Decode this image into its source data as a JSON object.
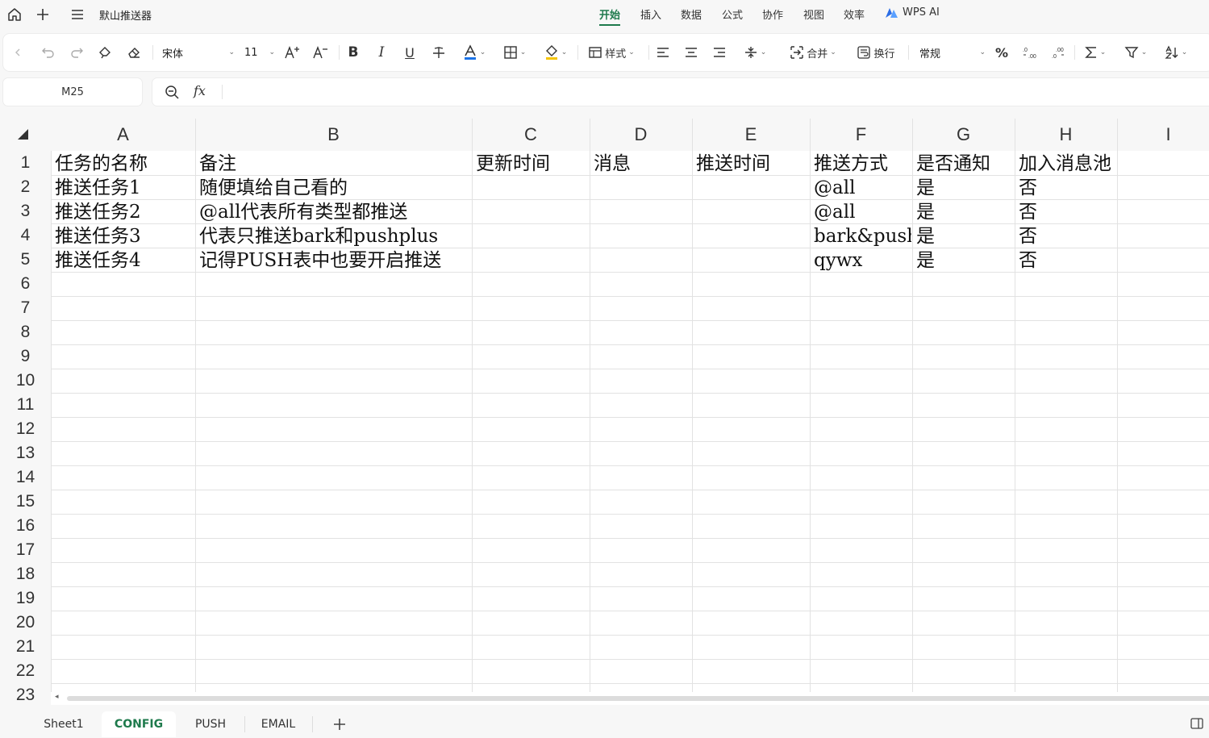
{
  "titlebar": {
    "doc_title": "默山推送器",
    "menu": [
      "开始",
      "插入",
      "数据",
      "公式",
      "协作",
      "视图",
      "效率"
    ],
    "wps_ai": "WPS AI"
  },
  "ribbon": {
    "font_name": "宋体",
    "font_size": "11",
    "styles_label": "样式",
    "merge_label": "合并",
    "wrap_label": "换行",
    "number_format": "常规",
    "percent": "%",
    "font_color": "#1a73e8",
    "fill_color": "#f5c400"
  },
  "namebox": {
    "value": "M25"
  },
  "formulabar": {
    "fx": "fx",
    "value": ""
  },
  "columns": [
    "A",
    "B",
    "C",
    "D",
    "E",
    "F",
    "G",
    "H",
    "I"
  ],
  "rows": [
    "1",
    "2",
    "3",
    "4",
    "5",
    "6",
    "7",
    "8",
    "9",
    "10",
    "11",
    "12",
    "13",
    "14",
    "15",
    "16",
    "17",
    "18",
    "19",
    "20",
    "21",
    "22",
    "23"
  ],
  "cells": [
    [
      "任务的名称",
      "备注",
      "更新时间",
      "消息",
      "推送时间",
      "推送方式",
      "是否通知",
      "加入消息池"
    ],
    [
      "推送任务1",
      "随便填给自己看的",
      "",
      "",
      "",
      "@all",
      "是",
      "否"
    ],
    [
      "推送任务2",
      "@all代表所有类型都推送",
      "",
      "",
      "",
      "@all",
      "是",
      "否"
    ],
    [
      "推送任务3",
      "代表只推送bark和pushplus",
      "",
      "",
      "",
      "bark&push",
      "是",
      "否"
    ],
    [
      "推送任务4",
      "记得PUSH表中也要开启推送",
      "",
      "",
      "",
      "qywx",
      "是",
      "否"
    ]
  ],
  "sheets": [
    "Sheet1",
    "CONFIG",
    "PUSH",
    "EMAIL"
  ],
  "active_sheet": "CONFIG",
  "accent_color": "#1e7a4c"
}
